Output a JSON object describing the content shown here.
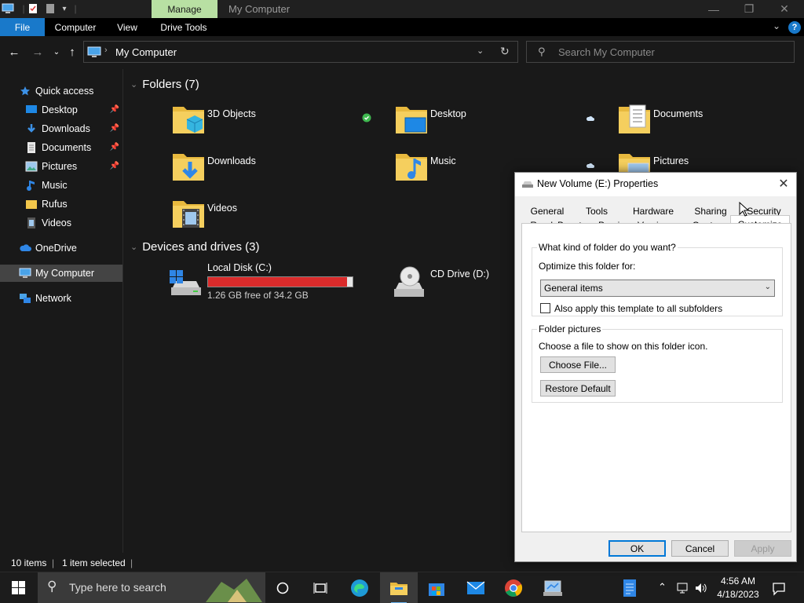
{
  "titlebar": {
    "context_tab": "Manage",
    "title": "My Computer"
  },
  "ribbon": {
    "tabs": [
      "File",
      "Computer",
      "View",
      "Drive Tools"
    ]
  },
  "navbar": {
    "address": "My Computer",
    "search_placeholder": "Search My Computer"
  },
  "sidebar": {
    "items": [
      {
        "label": "Quick access",
        "icon": "star-icon"
      },
      {
        "label": "Desktop",
        "icon": "desktop-icon",
        "pinned": true
      },
      {
        "label": "Downloads",
        "icon": "download-icon",
        "pinned": true
      },
      {
        "label": "Documents",
        "icon": "document-icon",
        "pinned": true
      },
      {
        "label": "Pictures",
        "icon": "picture-icon",
        "pinned": true
      },
      {
        "label": "Music",
        "icon": "music-icon"
      },
      {
        "label": "Rufus",
        "icon": "folder-icon"
      },
      {
        "label": "Videos",
        "icon": "video-icon"
      },
      {
        "label": "OneDrive",
        "icon": "cloud-icon"
      },
      {
        "label": "My Computer",
        "icon": "computer-icon",
        "selected": true
      },
      {
        "label": "Network",
        "icon": "network-icon"
      }
    ]
  },
  "main": {
    "folders_header": "Folders (7)",
    "folders": [
      {
        "label": "3D Objects",
        "icon": "3d-objects-folder-icon"
      },
      {
        "label": "Desktop",
        "icon": "desktop-folder-icon"
      },
      {
        "label": "Documents",
        "icon": "documents-folder-icon"
      },
      {
        "label": "Downloads",
        "icon": "downloads-folder-icon"
      },
      {
        "label": "Music",
        "icon": "music-folder-icon"
      },
      {
        "label": "Pictures",
        "icon": "pictures-folder-icon"
      },
      {
        "label": "Videos",
        "icon": "videos-folder-icon"
      }
    ],
    "drives_header": "Devices and drives (3)",
    "drives": [
      {
        "label": "Local Disk (C:)",
        "free": "1.26 GB free of 34.2 GB",
        "used_fraction": 0.963,
        "bar_color": "#da2b2b"
      },
      {
        "label": "CD Drive (D:)"
      }
    ]
  },
  "status": {
    "items": "10 items",
    "selected": "1 item selected"
  },
  "taskbar": {
    "search_placeholder": "Type here to search",
    "time": "4:56 AM",
    "date": "4/18/2023"
  },
  "dialog": {
    "title": "New Volume (E:) Properties",
    "tabs_row1": [
      "General",
      "Tools",
      "Hardware",
      "Sharing",
      "Security"
    ],
    "tabs_row2": [
      "ReadyBoost",
      "Previous Versions",
      "Quota",
      "Customize"
    ],
    "active_tab": "Customize",
    "section1_legend": "What kind of folder do you want?",
    "optimize_label": "Optimize this folder for:",
    "optimize_value": "General items",
    "apply_subfolders": "Also apply this template to all subfolders",
    "section2_legend": "Folder pictures",
    "choose_text": "Choose a file to show on this folder icon.",
    "choose_button": "Choose File...",
    "restore_button": "Restore Default",
    "ok": "OK",
    "cancel": "Cancel",
    "apply": "Apply"
  },
  "colors": {
    "accent": "#1979ca",
    "manage_tab": "#b8e0a3",
    "drive_bar": "#da2b2b"
  }
}
